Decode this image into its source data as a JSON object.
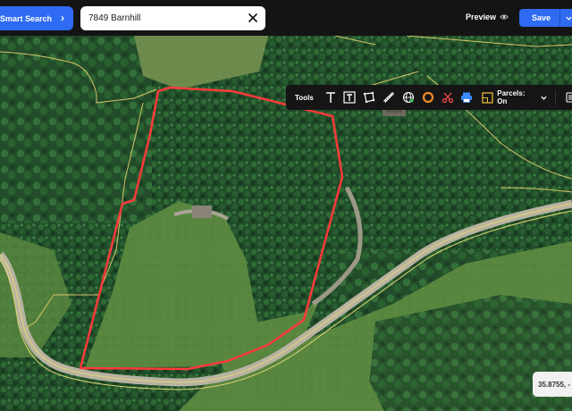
{
  "header": {
    "smart_search_label": "Smart Search",
    "search_value": "7849 Barnhill",
    "preview_label": "Preview",
    "save_label": "Save"
  },
  "toolbar": {
    "tools_label": "Tools",
    "icons": [
      "text-icon",
      "text-box-icon",
      "polygon-icon",
      "ruler-icon",
      "globe-icon",
      "circle-icon",
      "scissors-icon",
      "print-icon",
      "parcels-icon",
      "menu-icon"
    ],
    "parcels_label": "Parcels: On"
  },
  "map": {
    "coordinates": "35.8755, -"
  },
  "colors": {
    "accent": "#2f6bf2",
    "boundary": "#ff3a3a",
    "parcel_lines": "#d8c56a"
  }
}
